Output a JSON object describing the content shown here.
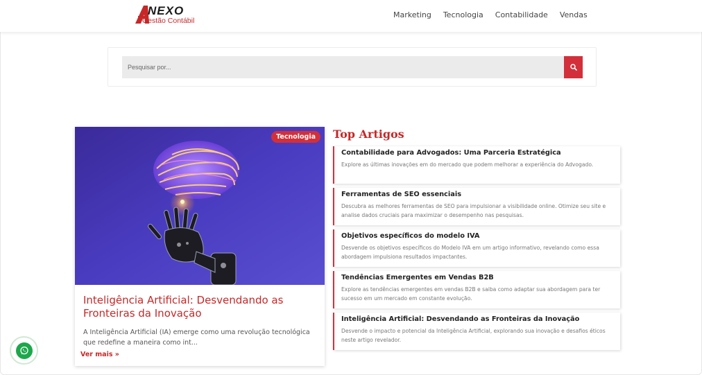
{
  "brand": {
    "logo_word": "NEXO",
    "logo_sub": "Gestão Contábil",
    "accent_color": "#d32f3a"
  },
  "nav": {
    "items": [
      "Marketing",
      "Tecnologia",
      "Contabilidade",
      "Vendas"
    ]
  },
  "search": {
    "placeholder": "Pesquisar por...",
    "button_icon": "search-icon"
  },
  "featured": {
    "badge": "Tecnologia",
    "title": "Inteligência Artificial: Desvendando as Fronteiras da Inovação",
    "excerpt": "A Inteligência Artificial (IA) emerge como uma revolução tecnológica que redefine a maneira como int...",
    "read_more": "Ver mais »",
    "image_subject": "robot hand holding glowing brain"
  },
  "top_articles": {
    "heading": "Top Artigos",
    "items": [
      {
        "title": "Contabilidade para Advogados: Uma Parceria Estratégica",
        "desc": "Explore as últimas inovações em do mercado que podem melhorar a experiência do Advogado."
      },
      {
        "title": "Ferramentas de SEO essenciais",
        "desc": "Descubra as melhores ferramentas de SEO para impulsionar a visibilidade online. Otimize seu site e analise dados cruciais para maximizar o desempenho nas pesquisas."
      },
      {
        "title": "Objetivos específicos do modelo IVA",
        "desc": "Desvende os objetivos específicos do Modelo IVA em um artigo informativo, revelando como essa abordagem impulsiona resultados impactantes."
      },
      {
        "title": "Tendências Emergentes em Vendas B2B",
        "desc": "Explore as tendências emergentes em vendas B2B e saiba como adaptar sua abordagem para ter sucesso em um mercado em constante evolução."
      },
      {
        "title": "Inteligência Artificial: Desvendando as Fronteiras da Inovação",
        "desc": "Desvende o impacto e potencial da Inteligência Artificial, explorando sua inovação e desafios éticos neste artigo revelador."
      }
    ]
  },
  "floating": {
    "whatsapp_icon": "whatsapp-icon",
    "whatsapp_color": "#1ca84b"
  }
}
